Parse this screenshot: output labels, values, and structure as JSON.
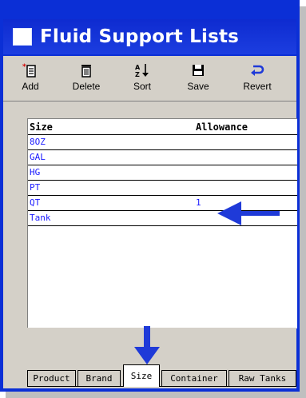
{
  "window": {
    "title": "Fluid Support Lists"
  },
  "toolbar": {
    "buttons": [
      {
        "label": "Add",
        "icon": "add-icon"
      },
      {
        "label": "Delete",
        "icon": "trash-icon"
      },
      {
        "label": "Sort",
        "icon": "sort-az-icon"
      },
      {
        "label": "Save",
        "icon": "save-icon"
      },
      {
        "label": "Revert",
        "icon": "revert-icon"
      }
    ]
  },
  "grid": {
    "columns": [
      "Size",
      "Allowance"
    ],
    "rows": [
      {
        "size": "8OZ",
        "allowance": ""
      },
      {
        "size": "GAL",
        "allowance": ""
      },
      {
        "size": "HG",
        "allowance": ""
      },
      {
        "size": "PT",
        "allowance": ""
      },
      {
        "size": "QT",
        "allowance": "1"
      },
      {
        "size": "Tank",
        "allowance": ""
      }
    ]
  },
  "tabs": [
    {
      "label": "Product",
      "active": false
    },
    {
      "label": "Brand",
      "active": false
    },
    {
      "label": "Size",
      "active": true
    },
    {
      "label": "Container",
      "active": false
    },
    {
      "label": "Raw Tanks",
      "active": false
    }
  ],
  "colors": {
    "titlebar": "#0b2fd6",
    "row_text": "#1a1aff",
    "arrow": "#1f3ad8"
  }
}
